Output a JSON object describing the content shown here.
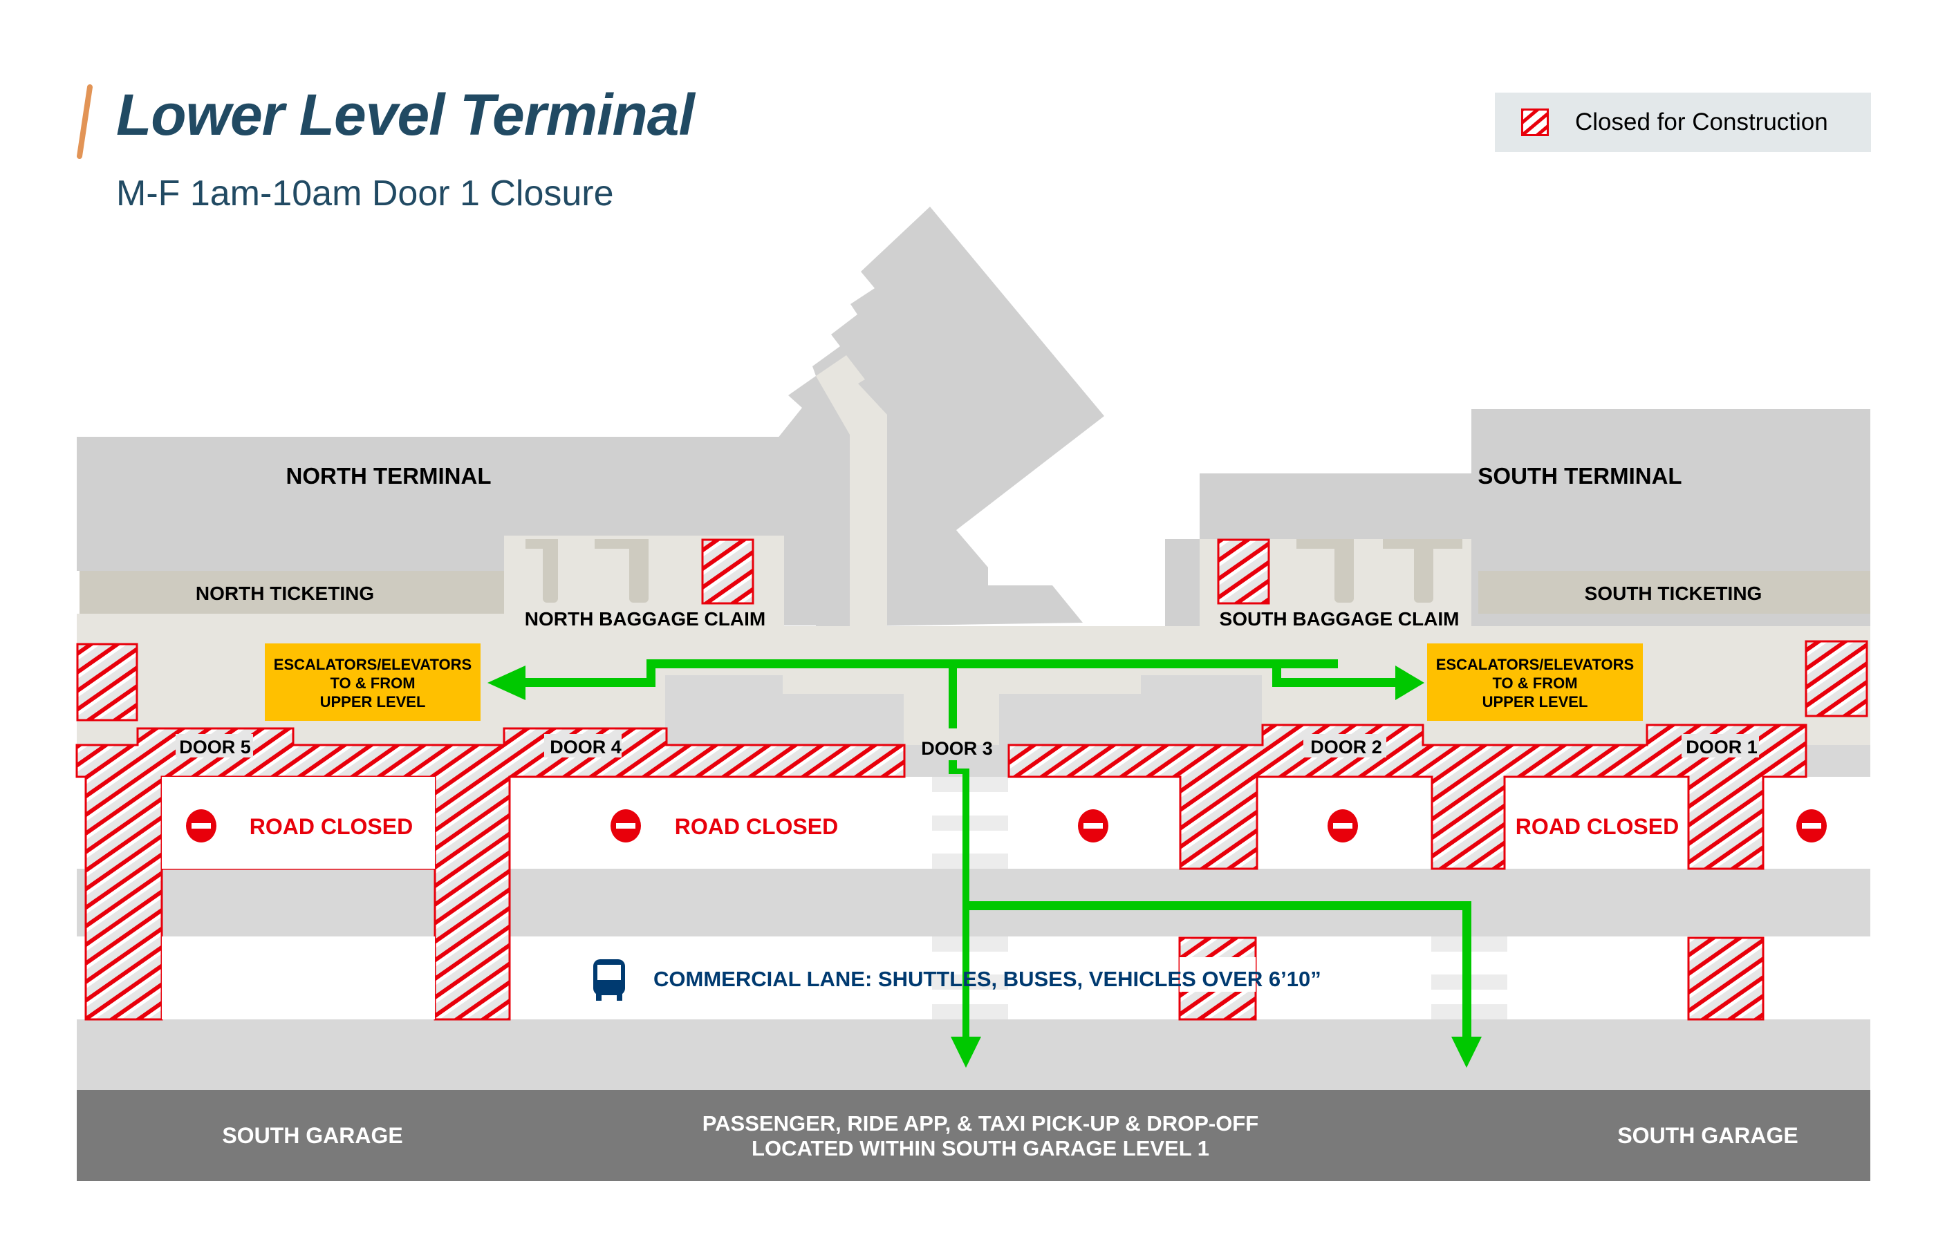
{
  "header": {
    "title": "Lower Level Terminal",
    "subtitle": "M-F 1am-10am Door 1 Closure"
  },
  "legend": {
    "items": [
      {
        "icon": "construction-hatch-icon",
        "label": "Closed for Construction"
      }
    ]
  },
  "map": {
    "areas": {
      "north_terminal": "NORTH TERMINAL",
      "south_terminal": "SOUTH TERMINAL",
      "north_ticketing": "NORTH TICKETING",
      "south_ticketing": "SOUTH TICKETING",
      "north_baggage": "NORTH BAGGAGE CLAIM",
      "south_baggage": "SOUTH BAGGAGE CLAIM"
    },
    "escalators": {
      "line1": "ESCALATORS/ELEVATORS",
      "line2": "TO & FROM",
      "line3": "UPPER LEVEL"
    },
    "doors": [
      "DOOR 5",
      "DOOR 4",
      "DOOR 3",
      "DOOR 2",
      "DOOR 1"
    ],
    "road_closed": "ROAD CLOSED",
    "commercial_lane": "COMMERCIAL LANE: SHUTTLES, BUSES, VEHICLES OVER 6’10”",
    "garage_left": "SOUTH GARAGE",
    "garage_right": "SOUTH GARAGE",
    "pickup_line1": "PASSENGER, RIDE APP, & TAXI PICK-UP & DROP-OFF",
    "pickup_line2": "LOCATED WITHIN SOUTH GARAGE LEVEL 1",
    "icons": {
      "do_not_enter": "do-not-enter-icon",
      "bus": "bus-icon",
      "route_arrow": "green-route-arrow"
    }
  },
  "colors": {
    "title": "#214a63",
    "accent_slash": "#e29456",
    "closed_red": "#e8000b",
    "route_green": "#00c800",
    "escalator_yellow": "#ffc000",
    "building_gray": "#d0d0d0",
    "floor_beige": "#e7e5df",
    "ticketing_tan": "#cecbc0",
    "road_gray": "#d8d8d8",
    "garage_dark": "#7a7a7a",
    "commercial_blue": "#003a70"
  }
}
